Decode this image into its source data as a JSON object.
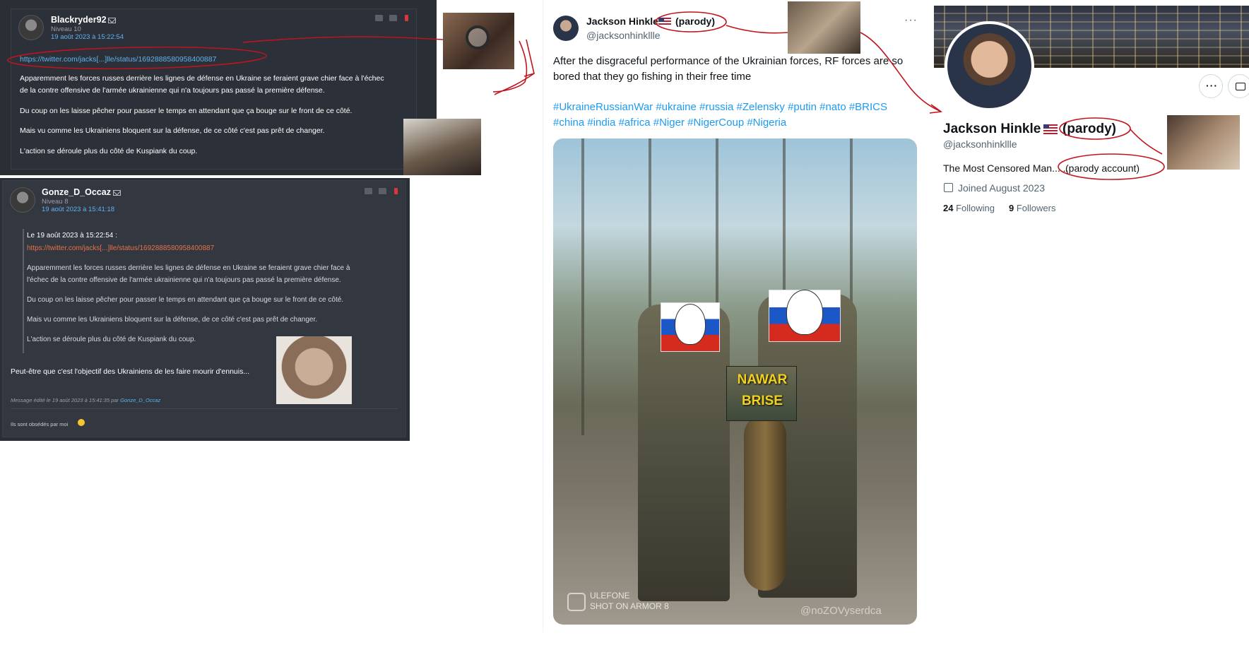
{
  "forum": {
    "post1": {
      "username": "Blackryder92",
      "level": "Niveau 10",
      "date": "19 août 2023 à 15:22:54",
      "link": "https://twitter.com/jacks[...]lle/status/1692888580958400887",
      "paragraphs": [
        "Apparemment les forces russes derrière les lignes de défense en Ukraine se feraient grave chier face à l'échec",
        "de la contre offensive de l'armée ukrainienne qui n'a toujours pas passé la première défense.",
        "Du coup on les laisse pêcher pour passer le temps en attendant que ça bouge sur le front de ce côté.",
        "Mais vu comme les Ukrainiens bloquent sur la défense, de ce côté c'est pas prêt de changer.",
        "L'action se déroule plus du côté de Kuspiank du coup."
      ]
    },
    "post2": {
      "username": "Gonze_D_Occaz",
      "level": "Niveau 8",
      "date": "19 août 2023 à 15:41:18",
      "quote": {
        "header": "Le 19 août 2023 à 15:22:54 :",
        "link": "https://twitter.com/jacks[...]lle/status/1692888580958400887",
        "lines": [
          "Apparemment les forces russes derrière les lignes de défense en Ukraine se feraient grave chier face à",
          "l'échec de la contre offensive de l'armée ukrainienne qui n'a toujours pas passé la première défense.",
          "Du coup on les laisse pêcher pour passer le temps en attendant que ça bouge sur le front de ce côté.",
          "Mais vu comme les Ukrainiens bloquent sur la défense, de ce côté c'est pas prêt de changer.",
          "L'action se déroule plus du côté de Kuspiank du coup."
        ]
      },
      "reply": "Peut-être que c'est l'objectif des Ukrainiens de les faire mourir d'ennuis...",
      "edit_note": "Message édité le 19 août 2023 à 15:41:35 par",
      "edit_user": "Gonze_D_Occaz",
      "signature": "Ils sont obsédés par moi"
    }
  },
  "tweet": {
    "name": "Jackson Hinkle",
    "parody": "(parody)",
    "handle": "@jacksonhinkllle",
    "more": "···",
    "text": "After the disgraceful performance of the Ukrainian forces, RF forces are so bored that they go fishing in their free time",
    "hashtags": "#UkraineRussianWar #ukraine #russia #Zelensky #putin #nato #BRICS #china #india #africa #Niger #NigerCoup #Nigeria",
    "photo": {
      "overlay_line1": "NAWAR",
      "overlay_line2": "BRISE",
      "watermark_brand": "ULEFONE",
      "watermark_model": "SHOT ON ARMOR 8",
      "watermark_channel": "@noZOVyserdca"
    }
  },
  "profile": {
    "name": "Jackson Hinkle",
    "parody": "(parody)",
    "handle": "@jacksonhinkllle",
    "bio": "The Most Censored Man......",
    "bio_suffix": "(parody account)",
    "joined": "Joined August 2023",
    "following_count": "24",
    "following_label": "Following",
    "followers_count": "9",
    "followers_label": "Followers",
    "more_button": "···"
  },
  "colors": {
    "forum_bg": "#2a2e35",
    "forum_link": "#5fb3f0",
    "quote_link": "#e8714a",
    "twitter_blue": "#1d9bf0",
    "annotation_red": "#c0141c",
    "overlay_yellow": "#f3d21d"
  }
}
